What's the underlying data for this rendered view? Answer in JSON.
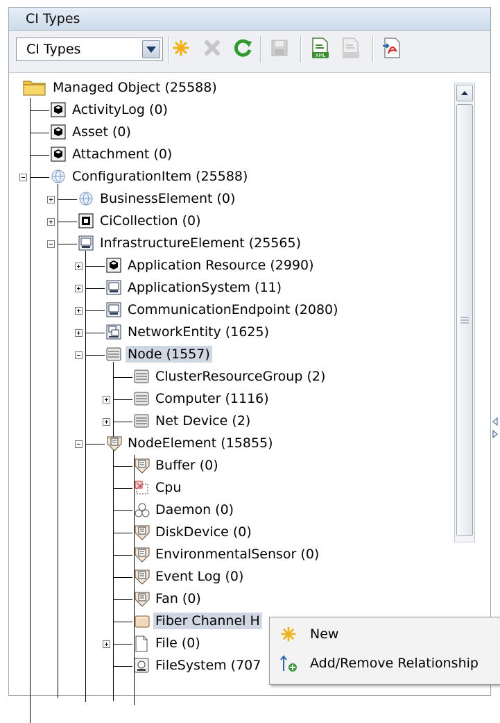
{
  "panel": {
    "title": "CI Types"
  },
  "toolbar": {
    "combo_value": "CI Types",
    "buttons": [
      "new-icon",
      "delete-icon",
      "refresh-icon",
      "save-icon",
      "export-xml-icon",
      "import-xml-icon",
      "export-pdf-icon"
    ]
  },
  "tree": {
    "nodes": [
      {
        "label": "Managed Object (25588)",
        "icon": "folder-icon",
        "level": 0
      },
      {
        "label": "ActivityLog (0)",
        "icon": "cube-icon",
        "level": 1
      },
      {
        "label": "Asset (0)",
        "icon": "cube-icon",
        "level": 1
      },
      {
        "label": "Attachment (0)",
        "icon": "cube-icon",
        "level": 1
      },
      {
        "label": "ConfigurationItem (25588)",
        "icon": "globe-icon",
        "level": 1,
        "expanded": true
      },
      {
        "label": "BusinessElement (0)",
        "icon": "globe-icon",
        "level": 2,
        "collapsed": true
      },
      {
        "label": "CiCollection (0)",
        "icon": "box-icon",
        "level": 2,
        "collapsed": true
      },
      {
        "label": "InfrastructureElement (25565)",
        "icon": "monitor-icon",
        "level": 2,
        "expanded": true
      },
      {
        "label": "Application Resource (2990)",
        "icon": "cube-icon",
        "level": 3,
        "collapsed": true
      },
      {
        "label": "ApplicationSystem (11)",
        "icon": "monitor-icon",
        "level": 3,
        "collapsed": true
      },
      {
        "label": "CommunicationEndpoint (2080)",
        "icon": "monitor-icon",
        "level": 3,
        "collapsed": true
      },
      {
        "label": "NetworkEntity (1625)",
        "icon": "network-icon",
        "level": 3,
        "collapsed": true
      },
      {
        "label": "Node (1557)",
        "icon": "server-icon",
        "level": 3,
        "expanded": true,
        "selected": true
      },
      {
        "label": "ClusterResourceGroup (2)",
        "icon": "server-icon",
        "level": 4
      },
      {
        "label": "Computer (1116)",
        "icon": "server-icon",
        "level": 4,
        "collapsed": true
      },
      {
        "label": "Net Device (2)",
        "icon": "server-icon",
        "level": 4,
        "collapsed": true
      },
      {
        "label": "NodeElement (15855)",
        "icon": "element-icon",
        "level": 3,
        "expanded": true
      },
      {
        "label": "Buffer (0)",
        "icon": "element-icon",
        "level": 4
      },
      {
        "label": "Cpu",
        "icon": "cpu-icon",
        "level": 4
      },
      {
        "label": "Daemon (0)",
        "icon": "daemon-icon",
        "level": 4
      },
      {
        "label": "DiskDevice (0)",
        "icon": "element-icon",
        "level": 4
      },
      {
        "label": "EnvironmentalSensor (0)",
        "icon": "element-icon",
        "level": 4
      },
      {
        "label": "Event Log (0)",
        "icon": "element-icon",
        "level": 4
      },
      {
        "label": "Fan (0)",
        "icon": "element-icon",
        "level": 4
      },
      {
        "label": "Fiber Channel H",
        "icon": "fiber-icon",
        "level": 4,
        "highlighted": true
      },
      {
        "label": "File (0)",
        "icon": "file-icon",
        "level": 4,
        "collapsed": true
      },
      {
        "label": "FileSystem (707",
        "icon": "disk-icon",
        "level": 4
      }
    ]
  },
  "context_menu": {
    "items": [
      {
        "label": "New",
        "icon": "new-icon"
      },
      {
        "label": "Add/Remove Relationship",
        "icon": "add-relationship-icon"
      }
    ]
  },
  "colors": {
    "title_bg": "#d5e1ee",
    "selection": "#cfd7e3",
    "menu_bg": "#f3f3f3"
  }
}
